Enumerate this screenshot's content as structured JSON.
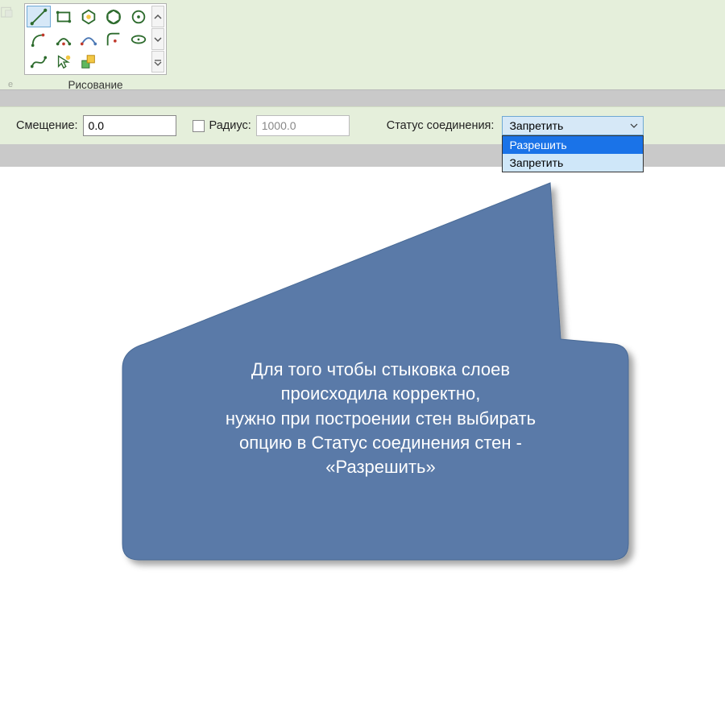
{
  "ribbon": {
    "stub_letter": "e",
    "panel_label": "Рисование",
    "tools": [
      {
        "name": "line-icon",
        "active": true
      },
      {
        "name": "rectangle-icon",
        "active": false
      },
      {
        "name": "polygon-in-icon",
        "active": false
      },
      {
        "name": "polygon-out-icon",
        "active": false
      },
      {
        "name": "circle-icon",
        "active": false
      },
      {
        "name": "arc-start-icon",
        "active": false
      },
      {
        "name": "arc-center-icon",
        "active": false
      },
      {
        "name": "arc-tangent-icon",
        "active": false
      },
      {
        "name": "fillet-icon",
        "active": false
      },
      {
        "name": "ellipse-icon",
        "active": false
      },
      {
        "name": "spline-icon",
        "active": false
      },
      {
        "name": "pick-arrow-icon",
        "active": false
      },
      {
        "name": "box-move-icon",
        "active": false
      }
    ]
  },
  "options": {
    "offset_label": "Смещение:",
    "offset_value": "0.0",
    "radius_label": "Радиус:",
    "radius_value": "1000.0",
    "radius_enabled": false,
    "status_label": "Статус соединения:",
    "status_value": "Запретить",
    "status_options": [
      "Разрешить",
      "Запретить"
    ],
    "status_selected_index": 0
  },
  "callout": {
    "line1": "Для того чтобы стыковка слоев",
    "line2": "происходила корректно,",
    "line3": "нужно при построении стен выбирать",
    "line4": "опцию в Статус соединения стен -",
    "line5": "«Разрешить»"
  },
  "colors": {
    "ribbon_bg": "#e5efdb",
    "callout_fill": "#5a7aa8",
    "highlight_blue": "#1a73e8"
  }
}
